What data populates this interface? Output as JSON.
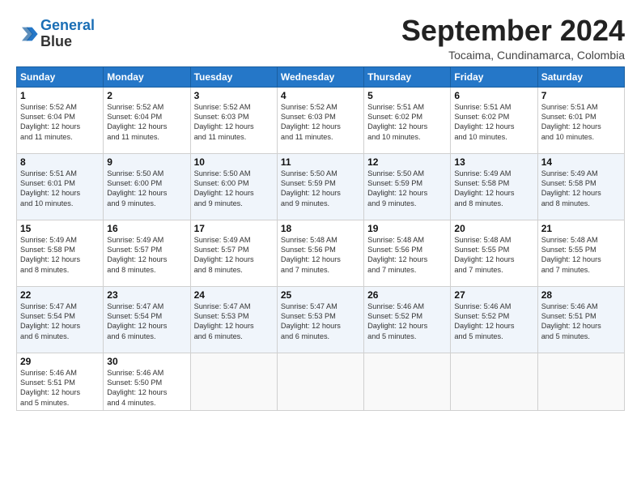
{
  "header": {
    "logo_line1": "General",
    "logo_line2": "Blue",
    "month_title": "September 2024",
    "subtitle": "Tocaima, Cundinamarca, Colombia"
  },
  "weekdays": [
    "Sunday",
    "Monday",
    "Tuesday",
    "Wednesday",
    "Thursday",
    "Friday",
    "Saturday"
  ],
  "weeks": [
    [
      {
        "day": "1",
        "lines": [
          "Sunrise: 5:52 AM",
          "Sunset: 6:04 PM",
          "Daylight: 12 hours",
          "and 11 minutes."
        ]
      },
      {
        "day": "2",
        "lines": [
          "Sunrise: 5:52 AM",
          "Sunset: 6:04 PM",
          "Daylight: 12 hours",
          "and 11 minutes."
        ]
      },
      {
        "day": "3",
        "lines": [
          "Sunrise: 5:52 AM",
          "Sunset: 6:03 PM",
          "Daylight: 12 hours",
          "and 11 minutes."
        ]
      },
      {
        "day": "4",
        "lines": [
          "Sunrise: 5:52 AM",
          "Sunset: 6:03 PM",
          "Daylight: 12 hours",
          "and 11 minutes."
        ]
      },
      {
        "day": "5",
        "lines": [
          "Sunrise: 5:51 AM",
          "Sunset: 6:02 PM",
          "Daylight: 12 hours",
          "and 10 minutes."
        ]
      },
      {
        "day": "6",
        "lines": [
          "Sunrise: 5:51 AM",
          "Sunset: 6:02 PM",
          "Daylight: 12 hours",
          "and 10 minutes."
        ]
      },
      {
        "day": "7",
        "lines": [
          "Sunrise: 5:51 AM",
          "Sunset: 6:01 PM",
          "Daylight: 12 hours",
          "and 10 minutes."
        ]
      }
    ],
    [
      {
        "day": "8",
        "lines": [
          "Sunrise: 5:51 AM",
          "Sunset: 6:01 PM",
          "Daylight: 12 hours",
          "and 10 minutes."
        ]
      },
      {
        "day": "9",
        "lines": [
          "Sunrise: 5:50 AM",
          "Sunset: 6:00 PM",
          "Daylight: 12 hours",
          "and 9 minutes."
        ]
      },
      {
        "day": "10",
        "lines": [
          "Sunrise: 5:50 AM",
          "Sunset: 6:00 PM",
          "Daylight: 12 hours",
          "and 9 minutes."
        ]
      },
      {
        "day": "11",
        "lines": [
          "Sunrise: 5:50 AM",
          "Sunset: 5:59 PM",
          "Daylight: 12 hours",
          "and 9 minutes."
        ]
      },
      {
        "day": "12",
        "lines": [
          "Sunrise: 5:50 AM",
          "Sunset: 5:59 PM",
          "Daylight: 12 hours",
          "and 9 minutes."
        ]
      },
      {
        "day": "13",
        "lines": [
          "Sunrise: 5:49 AM",
          "Sunset: 5:58 PM",
          "Daylight: 12 hours",
          "and 8 minutes."
        ]
      },
      {
        "day": "14",
        "lines": [
          "Sunrise: 5:49 AM",
          "Sunset: 5:58 PM",
          "Daylight: 12 hours",
          "and 8 minutes."
        ]
      }
    ],
    [
      {
        "day": "15",
        "lines": [
          "Sunrise: 5:49 AM",
          "Sunset: 5:58 PM",
          "Daylight: 12 hours",
          "and 8 minutes."
        ]
      },
      {
        "day": "16",
        "lines": [
          "Sunrise: 5:49 AM",
          "Sunset: 5:57 PM",
          "Daylight: 12 hours",
          "and 8 minutes."
        ]
      },
      {
        "day": "17",
        "lines": [
          "Sunrise: 5:49 AM",
          "Sunset: 5:57 PM",
          "Daylight: 12 hours",
          "and 8 minutes."
        ]
      },
      {
        "day": "18",
        "lines": [
          "Sunrise: 5:48 AM",
          "Sunset: 5:56 PM",
          "Daylight: 12 hours",
          "and 7 minutes."
        ]
      },
      {
        "day": "19",
        "lines": [
          "Sunrise: 5:48 AM",
          "Sunset: 5:56 PM",
          "Daylight: 12 hours",
          "and 7 minutes."
        ]
      },
      {
        "day": "20",
        "lines": [
          "Sunrise: 5:48 AM",
          "Sunset: 5:55 PM",
          "Daylight: 12 hours",
          "and 7 minutes."
        ]
      },
      {
        "day": "21",
        "lines": [
          "Sunrise: 5:48 AM",
          "Sunset: 5:55 PM",
          "Daylight: 12 hours",
          "and 7 minutes."
        ]
      }
    ],
    [
      {
        "day": "22",
        "lines": [
          "Sunrise: 5:47 AM",
          "Sunset: 5:54 PM",
          "Daylight: 12 hours",
          "and 6 minutes."
        ]
      },
      {
        "day": "23",
        "lines": [
          "Sunrise: 5:47 AM",
          "Sunset: 5:54 PM",
          "Daylight: 12 hours",
          "and 6 minutes."
        ]
      },
      {
        "day": "24",
        "lines": [
          "Sunrise: 5:47 AM",
          "Sunset: 5:53 PM",
          "Daylight: 12 hours",
          "and 6 minutes."
        ]
      },
      {
        "day": "25",
        "lines": [
          "Sunrise: 5:47 AM",
          "Sunset: 5:53 PM",
          "Daylight: 12 hours",
          "and 6 minutes."
        ]
      },
      {
        "day": "26",
        "lines": [
          "Sunrise: 5:46 AM",
          "Sunset: 5:52 PM",
          "Daylight: 12 hours",
          "and 5 minutes."
        ]
      },
      {
        "day": "27",
        "lines": [
          "Sunrise: 5:46 AM",
          "Sunset: 5:52 PM",
          "Daylight: 12 hours",
          "and 5 minutes."
        ]
      },
      {
        "day": "28",
        "lines": [
          "Sunrise: 5:46 AM",
          "Sunset: 5:51 PM",
          "Daylight: 12 hours",
          "and 5 minutes."
        ]
      }
    ],
    [
      {
        "day": "29",
        "lines": [
          "Sunrise: 5:46 AM",
          "Sunset: 5:51 PM",
          "Daylight: 12 hours",
          "and 5 minutes."
        ]
      },
      {
        "day": "30",
        "lines": [
          "Sunrise: 5:46 AM",
          "Sunset: 5:50 PM",
          "Daylight: 12 hours",
          "and 4 minutes."
        ]
      },
      {
        "day": "",
        "lines": []
      },
      {
        "day": "",
        "lines": []
      },
      {
        "day": "",
        "lines": []
      },
      {
        "day": "",
        "lines": []
      },
      {
        "day": "",
        "lines": []
      }
    ]
  ]
}
